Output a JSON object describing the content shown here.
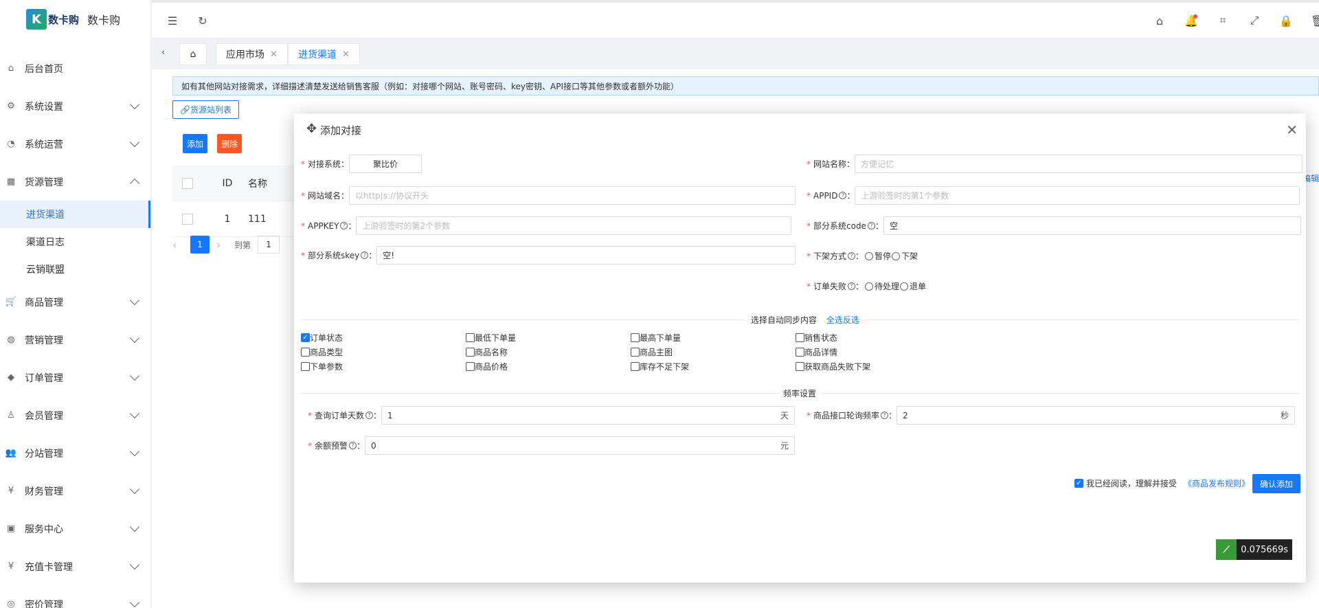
{
  "app": {
    "logo_mark": "K",
    "logo_mark_text": "数卡购",
    "logo_name": "数卡购"
  },
  "sidebar": {
    "items": [
      {
        "label": "后台首页",
        "icon": "home-icon"
      },
      {
        "label": "系统设置",
        "icon": "settings-icon"
      },
      {
        "label": "系统运营",
        "icon": "operations-icon"
      },
      {
        "label": "货源管理",
        "icon": "supply-icon"
      },
      {
        "label": "商品管理",
        "icon": "cart-icon"
      },
      {
        "label": "营销管理",
        "icon": "marketing-icon"
      },
      {
        "label": "订单管理",
        "icon": "order-icon"
      },
      {
        "label": "会员管理",
        "icon": "member-icon"
      },
      {
        "label": "分站管理",
        "icon": "substation-icon"
      },
      {
        "label": "财务管理",
        "icon": "finance-icon"
      },
      {
        "label": "服务中心",
        "icon": "service-icon"
      },
      {
        "label": "充值卡管理",
        "icon": "card-icon"
      },
      {
        "label": "密价管理",
        "icon": "price-icon"
      }
    ],
    "sub_items": [
      "进货渠道",
      "渠道日志",
      "云销联盟"
    ]
  },
  "tabs": {
    "home_icon": "home-icon",
    "items": [
      {
        "label": "应用市场"
      },
      {
        "label": "进货渠道"
      }
    ]
  },
  "content": {
    "notice": "如有其他网站对接需求，详细描述清楚发送给销售客服（例如：对接哪个网站、账号密码、key密钥、API接口等其他参数或者额外功能）",
    "source_list_btn": "货源站列表",
    "add_btn": "添加",
    "delete_btn": "删除",
    "table": {
      "col_id": "ID",
      "col_name": "名称",
      "rows": [
        {
          "id": "1",
          "name": "111"
        }
      ]
    },
    "pager": {
      "current": "1",
      "goto_label": "到第",
      "goto_value": "1"
    },
    "edit_link": "编辑"
  },
  "modal": {
    "title": "添加对接",
    "system_label": "对接系统",
    "system_value": "聚比价",
    "site_name_label": "网站名称",
    "site_name_placeholder": "方便记忆",
    "domain_label": "网站域名",
    "domain_placeholder": "以http|s://协议开头",
    "appid_label": "APPID",
    "appid_placeholder": "上游验签时的第1个参数",
    "appkey_label": "APPKEY",
    "appkey_placeholder": "上游验签时的第2个参数",
    "code_label": "部分系统code",
    "code_value": "空",
    "skey_label": "部分系统skey",
    "skey_value": "空!",
    "offshelf_label": "下架方式",
    "offshelf_options": [
      "暂停",
      "下架"
    ],
    "fail_label": "订单失败",
    "fail_options": [
      "待处理",
      "退单"
    ],
    "sync_section_label": "选择自动同步内容",
    "sync_select_all": "全选反选",
    "sync_options": [
      {
        "label": "订单状态",
        "checked": true
      },
      {
        "label": "最低下单量",
        "checked": false
      },
      {
        "label": "最高下单量",
        "checked": false
      },
      {
        "label": "销售状态",
        "checked": false
      },
      {
        "label": "商品类型",
        "checked": false
      },
      {
        "label": "商品名称",
        "checked": false
      },
      {
        "label": "商品主图",
        "checked": false
      },
      {
        "label": "商品详情",
        "checked": false
      },
      {
        "label": "下单参数",
        "checked": false
      },
      {
        "label": "商品价格",
        "checked": false
      },
      {
        "label": "库存不足下架",
        "checked": false
      },
      {
        "label": "获取商品失败下架",
        "checked": false
      }
    ],
    "freq_section_label": "频率设置",
    "query_days_label": "查询订单天数",
    "query_days_value": "1",
    "query_days_unit": "天",
    "poll_label": "商品接口轮询频率",
    "poll_value": "2",
    "poll_unit": "秒",
    "balance_label": "余额预警",
    "balance_value": "0",
    "balance_unit": "元",
    "agree_text": "我已经阅读，理解并接受",
    "rules_link": "《商品发布规则》",
    "confirm_btn": "确认添加"
  },
  "timer": {
    "value": "0.075669s"
  }
}
